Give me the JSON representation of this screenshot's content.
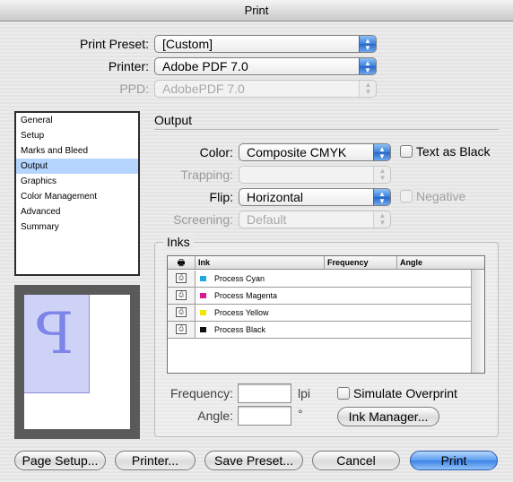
{
  "window": {
    "title": "Print"
  },
  "form": {
    "print_preset": {
      "label": "Print Preset:",
      "value": "[Custom]"
    },
    "printer": {
      "label": "Printer:",
      "value": "Adobe PDF 7.0"
    },
    "ppd": {
      "label": "PPD:",
      "value": "AdobePDF 7.0"
    }
  },
  "sidebar": {
    "items": [
      {
        "label": "General"
      },
      {
        "label": "Setup"
      },
      {
        "label": "Marks and Bleed"
      },
      {
        "label": "Output",
        "selected": true
      },
      {
        "label": "Graphics"
      },
      {
        "label": "Color Management"
      },
      {
        "label": "Advanced"
      },
      {
        "label": "Summary"
      }
    ]
  },
  "preview": {
    "glyph": "P"
  },
  "output": {
    "section_title": "Output",
    "color": {
      "label": "Color:",
      "value": "Composite CMYK"
    },
    "text_as_black": {
      "label": "Text as Black",
      "checked": false
    },
    "trapping": {
      "label": "Trapping:",
      "value": ""
    },
    "flip": {
      "label": "Flip:",
      "value": "Horizontal"
    },
    "negative": {
      "label": "Negative",
      "checked": false
    },
    "screening": {
      "label": "Screening:",
      "value": "Default"
    }
  },
  "inks": {
    "group_title": "Inks",
    "columns": [
      "Ink",
      "Frequency",
      "Angle"
    ],
    "rows": [
      {
        "name": "Process Cyan",
        "color": "#1fa7e0"
      },
      {
        "name": "Process Magenta",
        "color": "#d81b8c"
      },
      {
        "name": "Process Yellow",
        "color": "#f2e600"
      },
      {
        "name": "Process Black",
        "color": "#111111"
      }
    ],
    "frequency": {
      "label": "Frequency:",
      "value": "",
      "unit": "lpi"
    },
    "angle": {
      "label": "Angle:",
      "value": "",
      "unit": "°"
    },
    "simulate_overprint": {
      "label": "Simulate Overprint",
      "checked": false
    },
    "ink_manager_label": "Ink Manager..."
  },
  "buttons": {
    "page_setup": "Page Setup...",
    "printer": "Printer...",
    "save_preset": "Save Preset...",
    "cancel": "Cancel",
    "print": "Print"
  }
}
